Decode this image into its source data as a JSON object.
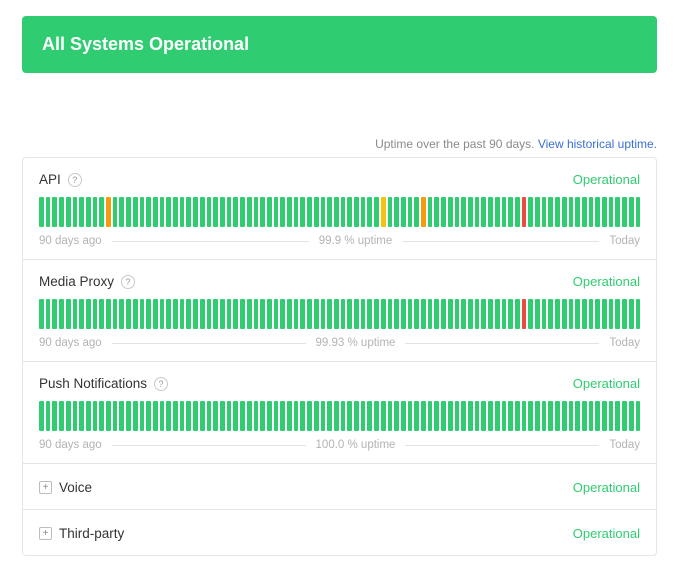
{
  "banner": {
    "text": "All Systems Operational"
  },
  "uptime_note": {
    "prefix": "Uptime over the past 90 days. ",
    "link": "View historical uptime."
  },
  "status_labels": {
    "operational": "Operational"
  },
  "legend": {
    "start": "90 days ago",
    "end": "Today"
  },
  "icons": {
    "help": "?",
    "expand": "+"
  },
  "components": [
    {
      "name": "API",
      "status": "operational",
      "uptime_label": "99.9 % uptime",
      "days": [
        "ok",
        "ok",
        "ok",
        "ok",
        "ok",
        "ok",
        "ok",
        "ok",
        "ok",
        "ok",
        "partial",
        "ok",
        "ok",
        "ok",
        "ok",
        "ok",
        "ok",
        "ok",
        "ok",
        "ok",
        "ok",
        "ok",
        "ok",
        "ok",
        "ok",
        "ok",
        "ok",
        "ok",
        "ok",
        "ok",
        "ok",
        "ok",
        "ok",
        "ok",
        "ok",
        "ok",
        "ok",
        "ok",
        "ok",
        "ok",
        "ok",
        "ok",
        "ok",
        "ok",
        "ok",
        "ok",
        "ok",
        "ok",
        "ok",
        "ok",
        "ok",
        "degraded",
        "ok",
        "ok",
        "ok",
        "ok",
        "ok",
        "partial",
        "ok",
        "ok",
        "ok",
        "ok",
        "ok",
        "ok",
        "ok",
        "ok",
        "ok",
        "ok",
        "ok",
        "ok",
        "ok",
        "ok",
        "major",
        "ok",
        "ok",
        "ok",
        "ok",
        "ok",
        "ok",
        "ok",
        "ok",
        "ok",
        "ok",
        "ok",
        "ok",
        "ok",
        "ok",
        "ok",
        "ok",
        "ok"
      ]
    },
    {
      "name": "Media Proxy",
      "status": "operational",
      "uptime_label": "99.93 % uptime",
      "days": [
        "ok",
        "ok",
        "ok",
        "ok",
        "ok",
        "ok",
        "ok",
        "ok",
        "ok",
        "ok",
        "ok",
        "ok",
        "ok",
        "ok",
        "ok",
        "ok",
        "ok",
        "ok",
        "ok",
        "ok",
        "ok",
        "ok",
        "ok",
        "ok",
        "ok",
        "ok",
        "ok",
        "ok",
        "ok",
        "ok",
        "ok",
        "ok",
        "ok",
        "ok",
        "ok",
        "ok",
        "ok",
        "ok",
        "ok",
        "ok",
        "ok",
        "ok",
        "ok",
        "ok",
        "ok",
        "ok",
        "ok",
        "ok",
        "ok",
        "ok",
        "ok",
        "ok",
        "ok",
        "ok",
        "ok",
        "ok",
        "ok",
        "ok",
        "ok",
        "ok",
        "ok",
        "ok",
        "ok",
        "ok",
        "ok",
        "ok",
        "ok",
        "ok",
        "ok",
        "ok",
        "ok",
        "ok",
        "major",
        "ok",
        "ok",
        "ok",
        "ok",
        "ok",
        "ok",
        "ok",
        "ok",
        "ok",
        "ok",
        "ok",
        "ok",
        "ok",
        "ok",
        "ok",
        "ok",
        "ok"
      ]
    },
    {
      "name": "Push Notifications",
      "status": "operational",
      "uptime_label": "100.0 % uptime",
      "days": [
        "ok",
        "ok",
        "ok",
        "ok",
        "ok",
        "ok",
        "ok",
        "ok",
        "ok",
        "ok",
        "ok",
        "ok",
        "ok",
        "ok",
        "ok",
        "ok",
        "ok",
        "ok",
        "ok",
        "ok",
        "ok",
        "ok",
        "ok",
        "ok",
        "ok",
        "ok",
        "ok",
        "ok",
        "ok",
        "ok",
        "ok",
        "ok",
        "ok",
        "ok",
        "ok",
        "ok",
        "ok",
        "ok",
        "ok",
        "ok",
        "ok",
        "ok",
        "ok",
        "ok",
        "ok",
        "ok",
        "ok",
        "ok",
        "ok",
        "ok",
        "ok",
        "ok",
        "ok",
        "ok",
        "ok",
        "ok",
        "ok",
        "ok",
        "ok",
        "ok",
        "ok",
        "ok",
        "ok",
        "ok",
        "ok",
        "ok",
        "ok",
        "ok",
        "ok",
        "ok",
        "ok",
        "ok",
        "ok",
        "ok",
        "ok",
        "ok",
        "ok",
        "ok",
        "ok",
        "ok",
        "ok",
        "ok",
        "ok",
        "ok",
        "ok",
        "ok",
        "ok",
        "ok",
        "ok",
        "ok"
      ]
    },
    {
      "name": "Voice",
      "status": "operational",
      "collapsed": true
    },
    {
      "name": "Third-party",
      "status": "operational",
      "collapsed": true
    }
  ]
}
